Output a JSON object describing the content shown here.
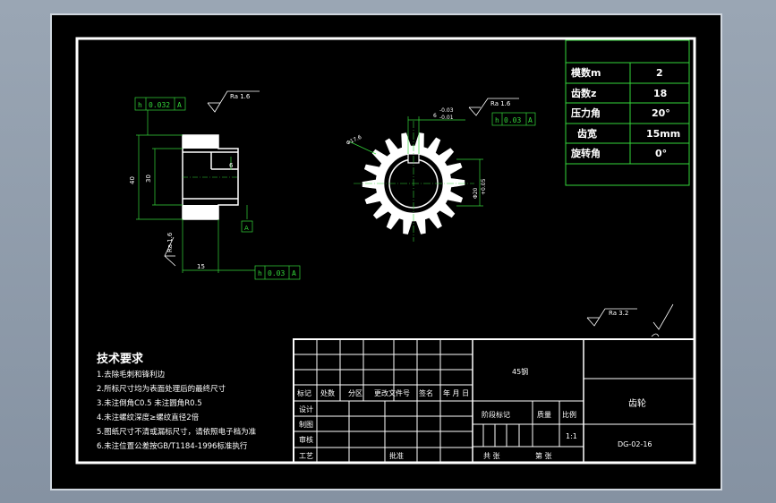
{
  "colors": {
    "line": "#ffffff",
    "dim": "#34d63a",
    "sheet": "#000000",
    "frame": "#cfd6de"
  },
  "params": [
    {
      "label": "模数m",
      "value": "2"
    },
    {
      "label": "齿数z",
      "value": "18"
    },
    {
      "label": "压力角",
      "value": "20°"
    },
    {
      "label": "齿宽",
      "value": "15mm"
    },
    {
      "label": "旋转角",
      "value": "0°"
    }
  ],
  "dims": {
    "h_tol_left": "h",
    "tol_left": "0.032",
    "datum_left": "A",
    "ra_top_left": "Ra 1.6",
    "d40": "40",
    "d30": "30",
    "d6": "6",
    "ra_side": "Ra 1.6",
    "d15": "15",
    "h_tol_bottom": "h",
    "tol_bottom": "0.03",
    "datum_bottom": "A",
    "ra_right": "Ra 1.6",
    "keyway": "6",
    "keyway_tol_upper": "-0.03",
    "keyway_tol_lower": "-0.01",
    "h_tol_right": "h",
    "tol_right": "0.03",
    "datum_right": "A",
    "outer_dia": "Φ17.6",
    "bore": "Φ20",
    "bore_tol": "+0.05",
    "ra_general": "Ra 3.2"
  },
  "tech": {
    "title": "技术要求",
    "lines": [
      "1.去除毛刺和锋利边",
      "2.所标尺寸均为表面处理后的最终尺寸",
      "3.未注倒角C0.5 未注圆角R0.5",
      "4.未注螺纹深度≥螺纹直径2倍",
      "5.图纸尺寸不清或漏标尺寸，请依照电子档为准",
      "6.未注位置公差按GB/T1184-1996标准执行"
    ]
  },
  "titleblock": {
    "material": "45钢",
    "part_name": "齿轮",
    "drawing_no": "DG-02-16",
    "scale": "1:1",
    "rev_headers": [
      "标记",
      "处数",
      "分区",
      "更改文件号",
      "签名",
      "年 月 日"
    ],
    "roles": [
      "设计",
      "制图",
      "审核",
      "工艺"
    ],
    "approve": "批准",
    "stage_headers": [
      "阶段标记",
      "质量",
      "比例"
    ],
    "sheet_total": "共 张",
    "sheet_no": "第 张"
  }
}
